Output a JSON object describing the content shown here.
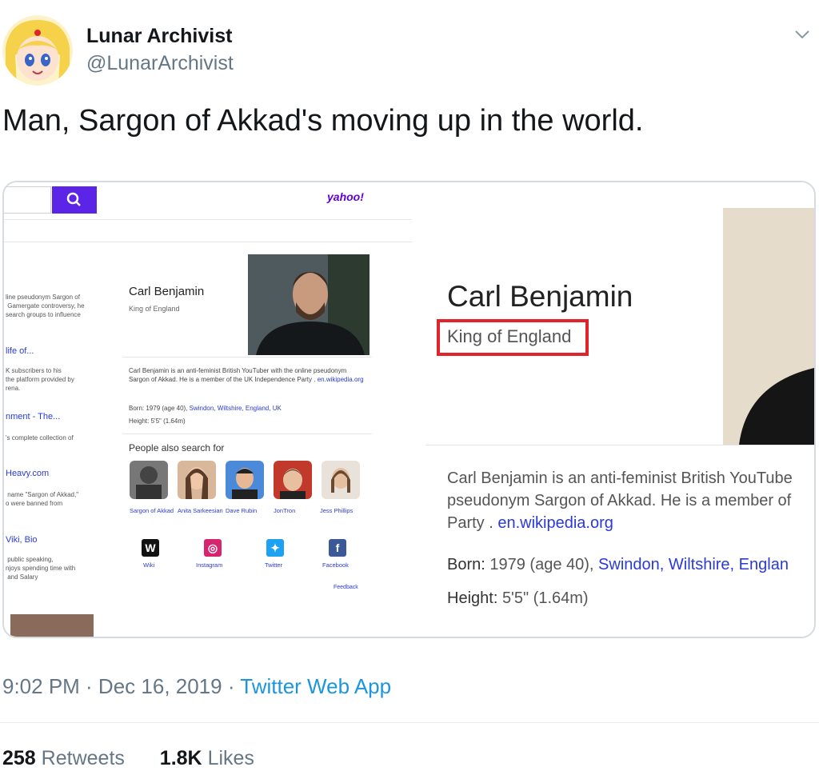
{
  "author": {
    "display_name": "Lunar Archivist",
    "handle": "@LunarArchivist"
  },
  "tweet": {
    "text": "Man, Sargon of Akkad's moving up in the world."
  },
  "screenshot": {
    "logo": "yahoo!",
    "left_snippets": [
      {
        "text": "line pseudonym Sargon of\n Gamergate controversy, he\nsearch groups to influence"
      },
      {
        "link": "life of...",
        "text": "K subscribers to his\nthe platform provided by\nrena."
      },
      {
        "link": "nment - The...",
        "text": "'s complete collection of"
      },
      {
        "link": "Heavy.com",
        "text": " name \"Sargon of Akkad,\"\no were banned from"
      },
      {
        "link": "Viki, Bio",
        "text": " public speaking,\nnjoys spending time with\n and Salary"
      }
    ],
    "knowledge_panel": {
      "name": "Carl Benjamin",
      "subtitle": "King of England",
      "description": "Carl Benjamin is an anti-feminist British YouTuber with the online pseudonym Sargon of Akkad. He is a member of the UK Independence Party .",
      "wiki_link": "en.wikipedia.org",
      "born_label": "Born:",
      "born_value": "1979 (age 40),",
      "born_place": "Swindon, Wiltshire, England, UK",
      "height_label": "Height:",
      "height_value": "5'5\" (1.64m)",
      "people_also_search_title": "People also search for",
      "people": [
        {
          "name": "Sargon of Akkad"
        },
        {
          "name": "Anita Sarkeesian"
        },
        {
          "name": "Dave Rubin"
        },
        {
          "name": "JonTron"
        },
        {
          "name": "Jess Phillips"
        }
      ],
      "socials": [
        {
          "label": "Wiki",
          "glyph": "W",
          "color": "#111111"
        },
        {
          "label": "Instagram",
          "glyph": "◎",
          "color": "#d6246e"
        },
        {
          "label": "Twitter",
          "glyph": "✦",
          "color": "#1da1f2"
        },
        {
          "label": "Facebook",
          "glyph": "f",
          "color": "#3b5998"
        }
      ],
      "feedback": "Feedback"
    },
    "zoom": {
      "name": "Carl Benjamin",
      "subtitle": "King of England",
      "desc_line1": "Carl Benjamin is an anti-feminist British YouTube",
      "desc_line2": "pseudonym Sargon of Akkad. He is a member of",
      "desc_line3_a": "Party .",
      "desc_line3_link": "en.wikipedia.org",
      "born_label": "Born:",
      "born_value": "1979 (age 40),",
      "born_place": "Swindon, Wiltshire, Englan",
      "height_label": "Height:",
      "height_value": "5'5\" (1.64m)"
    }
  },
  "footer": {
    "time": "9:02 PM · Dec 16, 2019 ·",
    "source": "Twitter Web App",
    "retweets_count": "258",
    "retweets_label": "Retweets",
    "likes_count": "1.8K",
    "likes_label": "Likes"
  },
  "colors": {
    "brand_blue": "#1b95e0",
    "highlight_red": "#e0242a",
    "yahoo_purple": "#6001d2"
  }
}
